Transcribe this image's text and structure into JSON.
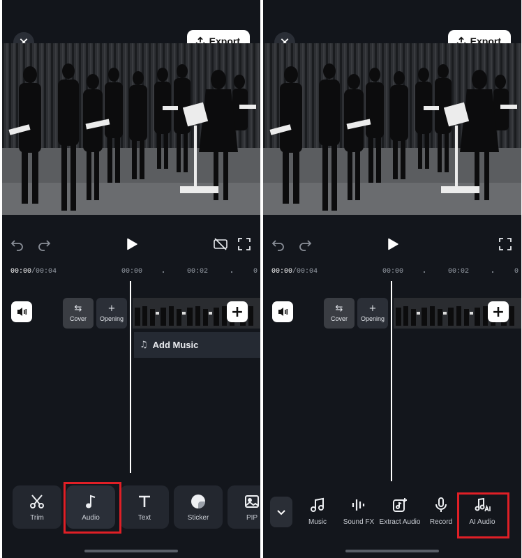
{
  "left_screen": {
    "close_icon": "close-icon",
    "export_label": "Export",
    "timecode_current": "00:00",
    "timecode_total": "/00:04",
    "ruler_ticks": [
      "00:00",
      "00:02",
      "0"
    ],
    "cover_label": "Cover",
    "opening_label": "Opening",
    "add_music_label": "Add Music",
    "tools": [
      {
        "label": "Trim",
        "icon": "scissors-icon"
      },
      {
        "label": "Audio",
        "icon": "music-note-icon"
      },
      {
        "label": "Text",
        "icon": "text-icon"
      },
      {
        "label": "Sticker",
        "icon": "sticker-icon"
      },
      {
        "label": "PIP",
        "icon": "image-icon"
      }
    ],
    "highlighted_tool": "Audio"
  },
  "right_screen": {
    "export_label": "Export",
    "timecode_current": "00:00",
    "timecode_total": "/00:04",
    "ruler_ticks": [
      "00:00",
      "00:02",
      "0"
    ],
    "cover_label": "Cover",
    "opening_label": "Opening",
    "audio_tools": [
      {
        "label": "Music",
        "icon": "music-icon"
      },
      {
        "label": "Sound FX",
        "icon": "sound-fx-icon"
      },
      {
        "label": "Extract Audio",
        "icon": "extract-audio-icon"
      },
      {
        "label": "Record",
        "icon": "microphone-icon"
      },
      {
        "label": "AI Audio",
        "icon": "ai-audio-icon"
      }
    ],
    "highlighted_tool": "AI Audio"
  },
  "colors": {
    "background": "#13161c",
    "highlight": "#e01f26",
    "button_white": "#ffffff"
  }
}
